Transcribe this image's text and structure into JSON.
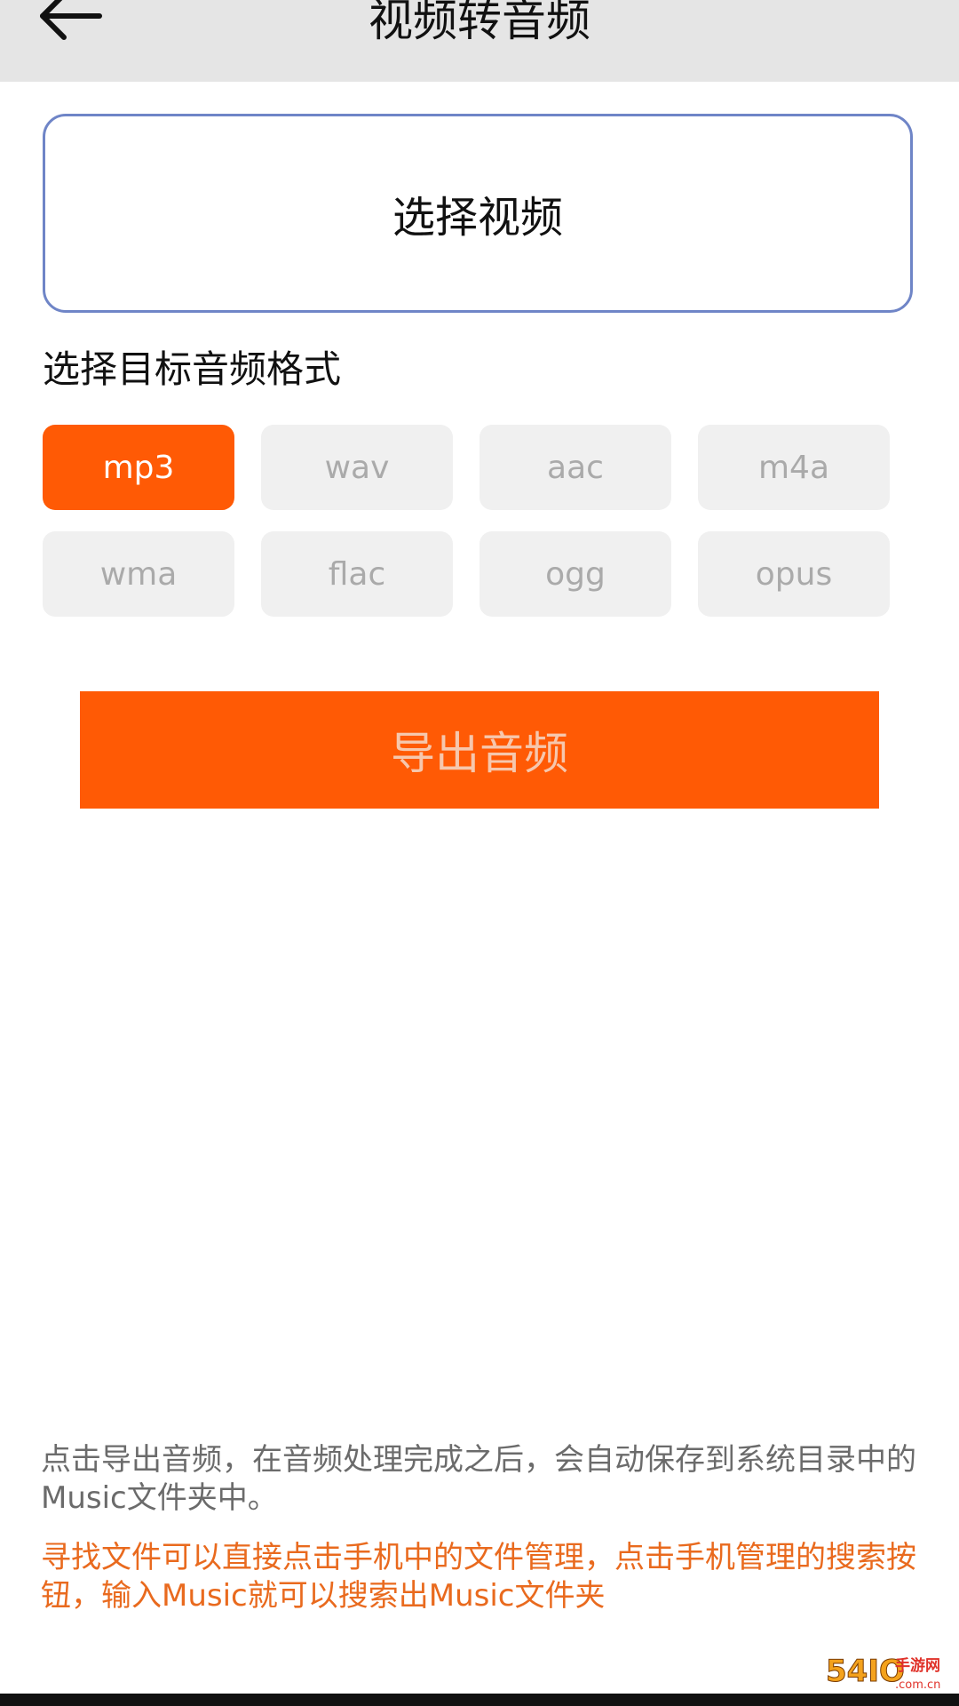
{
  "header": {
    "title": "视频转音频",
    "back_icon": "arrow-left-icon"
  },
  "select_video": {
    "label": "选择视频"
  },
  "format_section": {
    "label": "选择目标音频格式",
    "selected": "mp3",
    "formats": [
      "mp3",
      "wav",
      "aac",
      "m4a",
      "wma",
      "flac",
      "ogg",
      "opus"
    ]
  },
  "export": {
    "label": "导出音频"
  },
  "info": {
    "text": "点击导出音频，在音频处理完成之后，会自动保存到系统目录中的Music文件夹中。",
    "tip": "寻找文件可以直接点击手机中的文件管理，点击手机管理的搜索按钮，输入Music就可以搜索出Music文件夹"
  },
  "watermark": {
    "text": "54IO手游网 .com.cn"
  },
  "colors": {
    "accent": "#ff5a05",
    "header_bg": "#e5e5e5",
    "border_blue": "#6f85c7",
    "chip_bg": "#f0f0f0",
    "chip_text": "#aaaaaa",
    "tip_text": "#e96a1e",
    "info_text": "#6b6b6b"
  }
}
